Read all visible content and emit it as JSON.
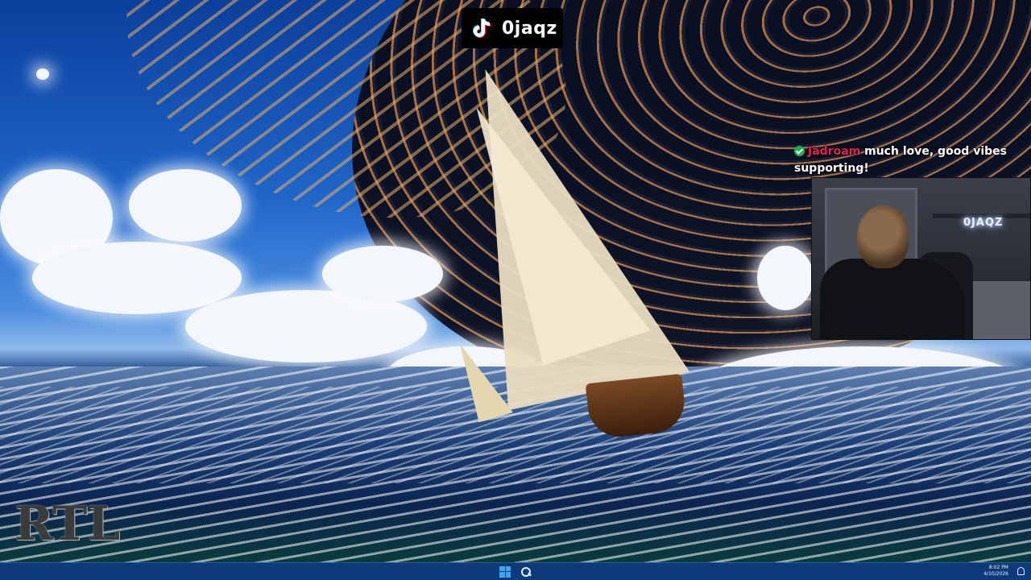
{
  "overlay": {
    "tiktok": {
      "icon": "tiktok-logo-icon",
      "username": "0jaqz"
    },
    "chat_message": {
      "badge_icon": "verified-check-icon",
      "badge_color": "#1fae4b",
      "username": "Jadroam",
      "username_color": "#e0244f",
      "text": "much love, good vibes supporting!"
    },
    "webcam": {
      "neon_sign": "0JAQZ"
    },
    "logo": {
      "text": "RTL"
    }
  },
  "taskbar": {
    "items": [
      {
        "icon": "windows-start-icon"
      },
      {
        "icon": "search-icon"
      }
    ],
    "tray": {
      "time": "8:02 PM",
      "date": "4/10/2026",
      "icon": "notification-bell-icon"
    },
    "accent": "#0f3a7a"
  }
}
